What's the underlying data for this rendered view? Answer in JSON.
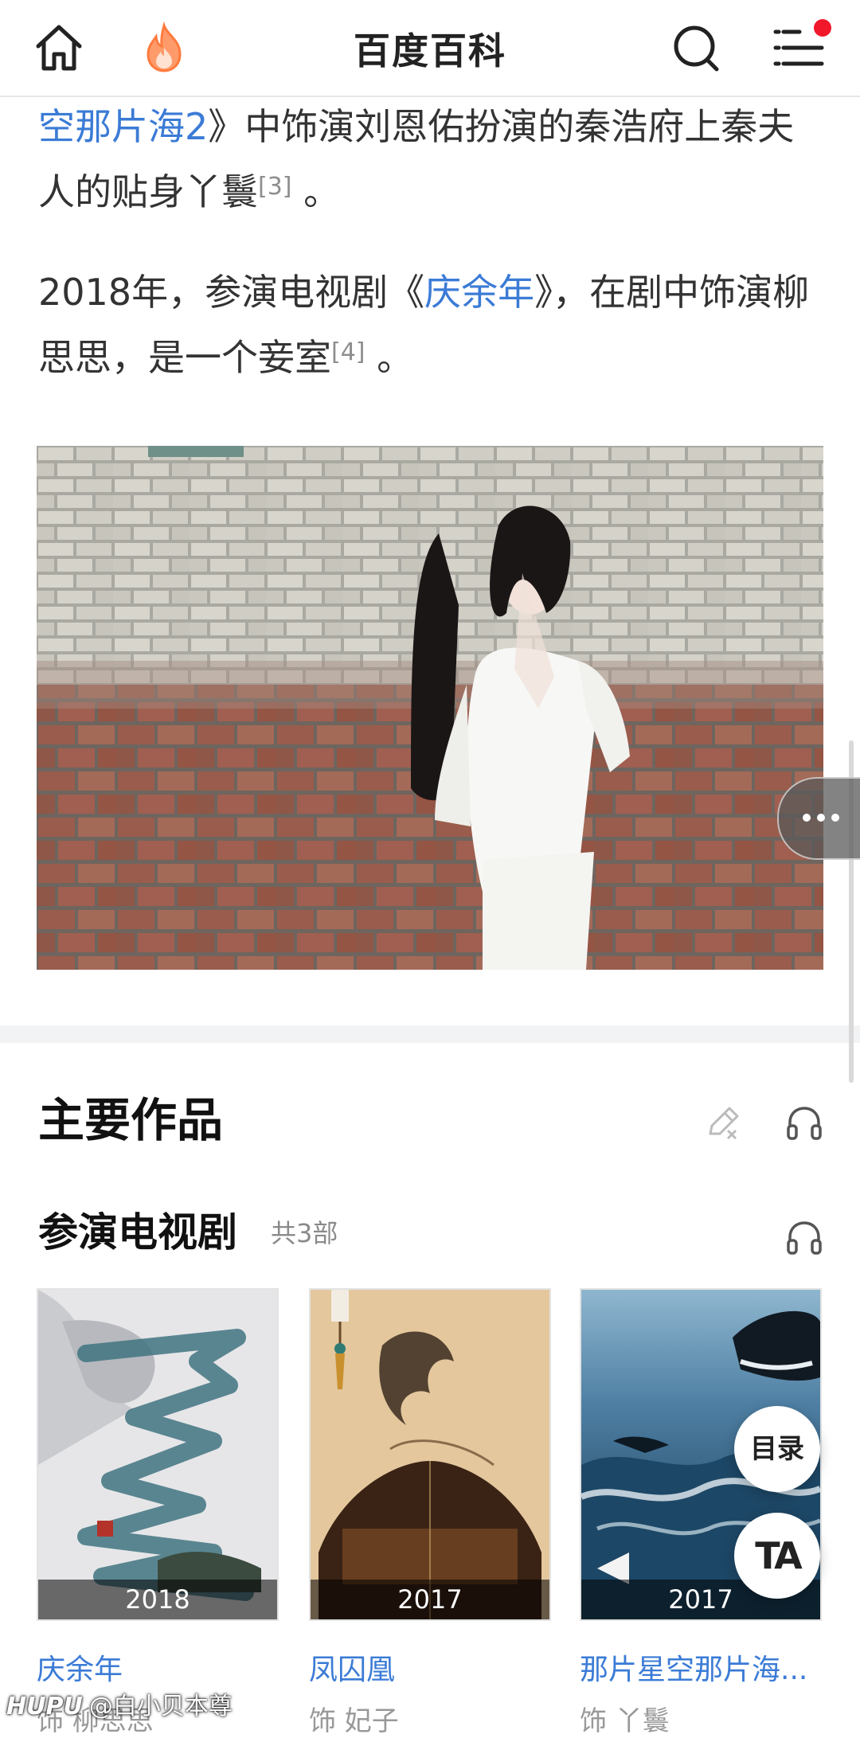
{
  "app": {
    "title": "百度百科"
  },
  "icons": {
    "home": "home-icon",
    "hot": "flame-icon",
    "search": "search-icon",
    "menu": "menu-icon",
    "edit": "edit-pencil-icon",
    "audio": "headphones-icon",
    "more": "more-dots-icon"
  },
  "colors": {
    "link": "#3b7bd6",
    "badge": "#f1182c"
  },
  "article": {
    "p1": {
      "link": "空那片海2",
      "text": "》中饰演刘恩佑扮演的秦浩府上秦夫人的贴身丫鬟",
      "ref": "[3]",
      "end": " 。"
    },
    "p2": {
      "pre": "2018年，参演电视剧《",
      "link": "庆余年",
      "text": "》，在剧中饰演柳思思，是一个妾室",
      "ref": "[4]",
      "end": " 。"
    }
  },
  "works": {
    "section_title": "主要作品",
    "tv_title": "参演电视剧",
    "tv_count": "共3部",
    "items": [
      {
        "name": "庆余年",
        "year": "2018",
        "role": "饰 柳思思"
      },
      {
        "name": "凤囚凰",
        "year": "2017",
        "role": "饰 妃子"
      },
      {
        "name": "那片星空那片海...",
        "year": "2017",
        "role": "饰 丫鬟"
      }
    ]
  },
  "fab": {
    "toc": "目录",
    "ta": "TA"
  },
  "watermark": {
    "brand": "HUPU",
    "text": "@白小贝本尊"
  }
}
